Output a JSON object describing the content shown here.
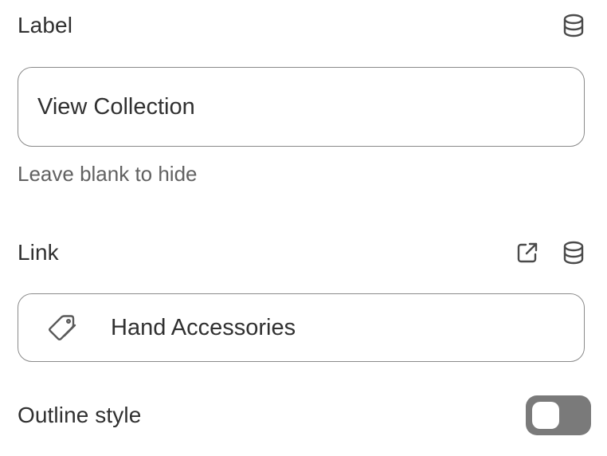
{
  "label_field": {
    "label": "Label",
    "value": "View Collection",
    "help": "Leave blank to hide",
    "icon": "database-icon"
  },
  "link_field": {
    "label": "Link",
    "value": "Hand Accessories",
    "icons": [
      "external-link-icon",
      "database-icon"
    ],
    "leading_icon": "tag-icon"
  },
  "outline_style": {
    "label": "Outline style",
    "enabled": false
  },
  "colors": {
    "text": "#303030",
    "muted": "#616161",
    "border": "#8a8a8a",
    "toggle_off": "#7a7a7a"
  }
}
